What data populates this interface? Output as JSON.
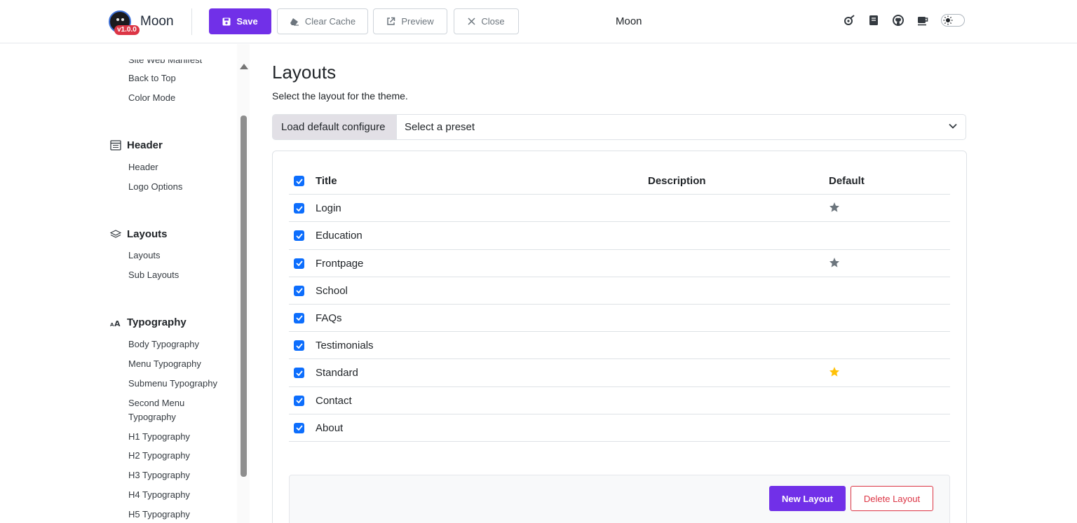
{
  "app": {
    "name": "Moon",
    "version": "v1.0.0",
    "center_title": "Moon"
  },
  "toolbar": {
    "save_label": "Save",
    "clear_cache_label": "Clear Cache",
    "preview_label": "Preview",
    "close_label": "Close"
  },
  "top_icons": [
    "rocket-icon",
    "book-icon",
    "github-icon",
    "coffee-icon",
    "sun-icon"
  ],
  "colors": {
    "accent": "#7130e8",
    "checkbox": "#0d6efd",
    "danger": "#dc3545",
    "star_default": "#ffc107",
    "star_muted": "#6c757d"
  },
  "sidebar": {
    "partial_item": "Site Web Manifest",
    "top_items": [
      "Back to Top",
      "Color Mode"
    ],
    "groups": [
      {
        "title": "Header",
        "icon": "header-icon",
        "items": [
          "Header",
          "Logo Options"
        ]
      },
      {
        "title": "Layouts",
        "icon": "layers-icon",
        "items": [
          "Layouts",
          "Sub Layouts"
        ]
      },
      {
        "title": "Typography",
        "icon": "typography-icon",
        "items": [
          "Body Typography",
          "Menu Typography",
          "Submenu Typography",
          "Second Menu",
          "Typography",
          "H1 Typography",
          "H2 Typography",
          "H3 Typography",
          "H4 Typography",
          "H5 Typography"
        ]
      }
    ]
  },
  "main": {
    "title": "Layouts",
    "subtitle": "Select the layout for the theme.",
    "preset_label": "Load default configure",
    "preset_placeholder": "Select a preset",
    "table": {
      "headers": {
        "title": "Title",
        "description": "Description",
        "default": "Default"
      },
      "rows": [
        {
          "title": "Login",
          "checked": true,
          "default": "muted"
        },
        {
          "title": "Education",
          "checked": true,
          "default": ""
        },
        {
          "title": "Frontpage",
          "checked": true,
          "default": "muted"
        },
        {
          "title": "School",
          "checked": true,
          "default": ""
        },
        {
          "title": "FAQs",
          "checked": true,
          "default": ""
        },
        {
          "title": "Testimonials",
          "checked": true,
          "default": ""
        },
        {
          "title": "Standard",
          "checked": true,
          "default": "active"
        },
        {
          "title": "Contact",
          "checked": true,
          "default": ""
        },
        {
          "title": "About",
          "checked": true,
          "default": ""
        }
      ]
    },
    "new_layout_label": "New Layout",
    "delete_layout_label": "Delete Layout"
  }
}
